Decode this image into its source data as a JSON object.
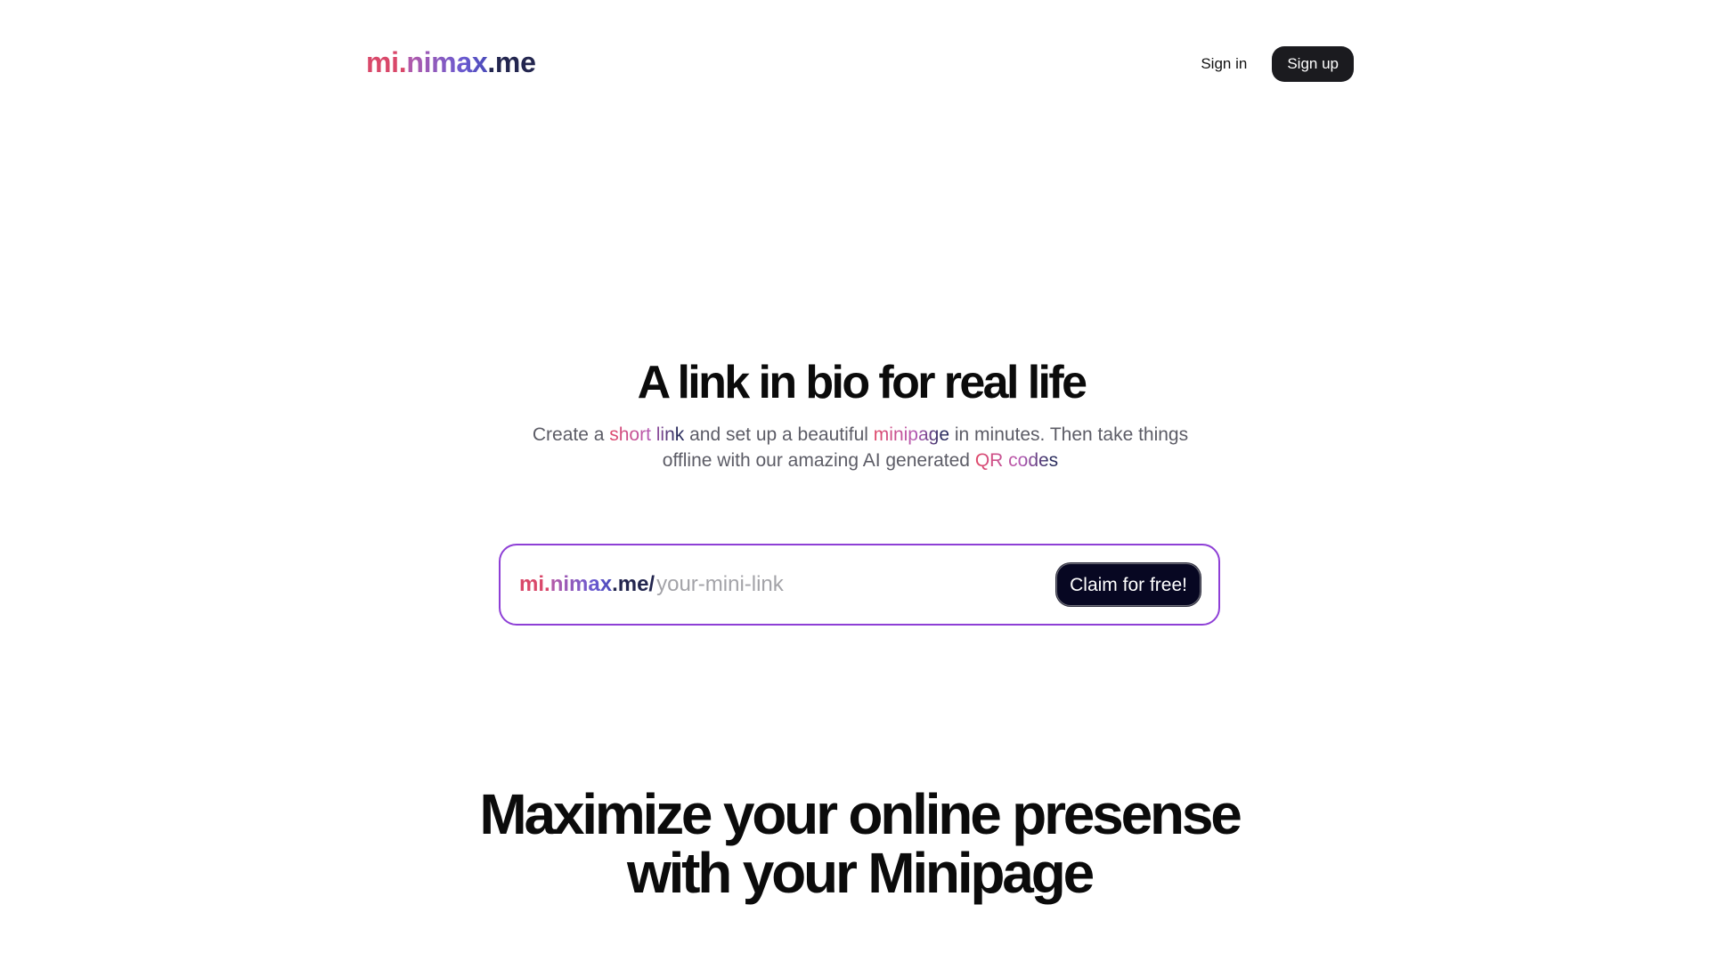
{
  "header": {
    "logo": {
      "part1": "mi.",
      "part2": "nimax",
      "part3": ".me"
    },
    "sign_in_label": "Sign in",
    "sign_up_label": "Sign up"
  },
  "hero": {
    "title": "A link in bio for real life",
    "subtitle": {
      "t1": "Create a ",
      "h1": "short link",
      "t2": " and set up a beautiful ",
      "h2": "minipage",
      "t3": " in minutes. Then take things offline with our amazing AI generated ",
      "h3": "QR codes"
    }
  },
  "claim": {
    "prefix": "mi.nimax.me/",
    "input_placeholder": "your-mini-link",
    "input_value": "",
    "button_label": "Claim for free!"
  },
  "section2": {
    "line1": "Maximize your online presense",
    "line2": "with your Minipage"
  },
  "colors": {
    "brand_pink": "#e04868",
    "brand_purple": "#6a5ad0",
    "brand_navy": "#1f2140",
    "claim_border": "#8e3fd6",
    "button_dark": "#1b1b1f"
  }
}
